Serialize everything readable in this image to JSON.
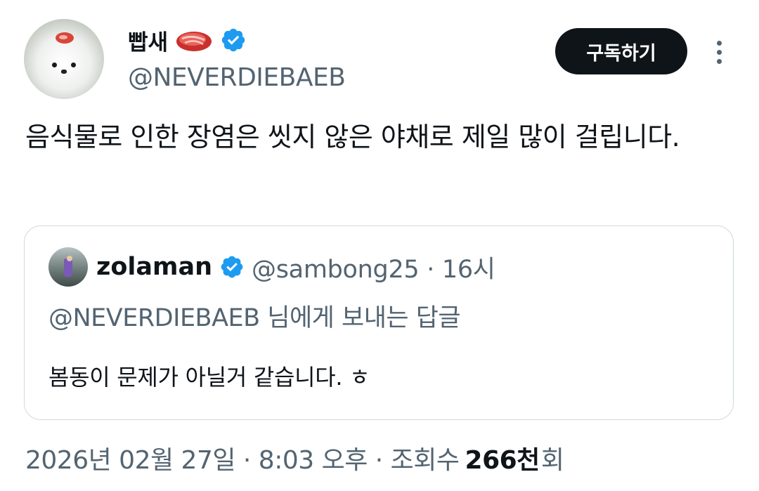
{
  "author": {
    "display_name": "빱새",
    "handle": "@NEVERDIEBAEB",
    "verified_icon": "verified-badge-icon",
    "emoji_icon": "meat-emoji-icon"
  },
  "subscribe_button": "구독하기",
  "more_icon": "more-vertical-icon",
  "tweet_text": "음식물로 인한 장염은 씻지 않은 야채로 제일 많이 걸립니다.",
  "quoted": {
    "display_name": "zolaman",
    "meta": "@sambong25 · 16시",
    "reply_to": "@NEVERDIEBAEB 님에게 보내는 답글",
    "text": "봄동이 문제가 아닐거 같습니다. ㅎ"
  },
  "footer": {
    "timestamp": "2026년 02월 27일 · 8:03 오후 · 조회수",
    "views_count": "266천",
    "views_unit": "회"
  },
  "colors": {
    "text_primary": "#0f1419",
    "text_secondary": "#536471",
    "verified_blue": "#1d9bf0",
    "border": "#cfd9de",
    "button_bg": "#0f1419"
  }
}
